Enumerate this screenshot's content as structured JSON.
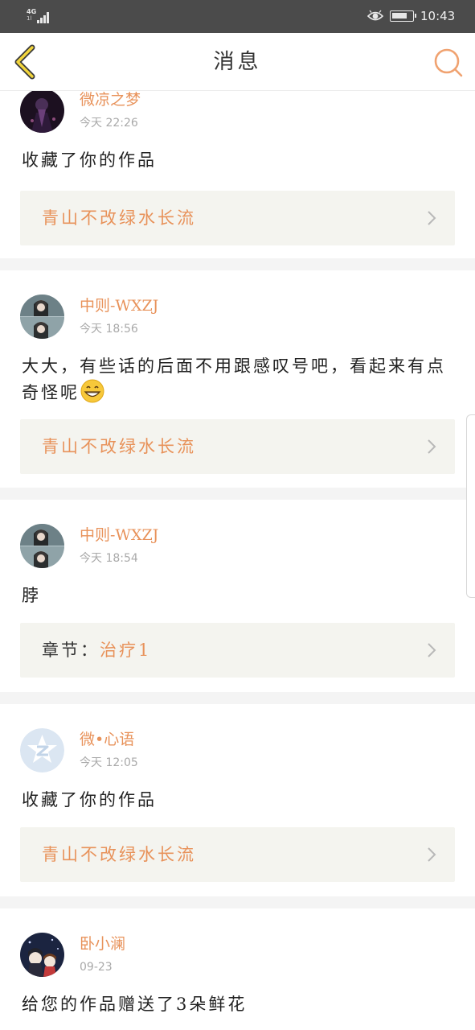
{
  "status_bar": {
    "network": "4G",
    "network_sub": "1l",
    "time": "10:43",
    "signal_icon": "signal-bars-icon",
    "eye_icon": "eye-comfort-icon",
    "battery_icon": "battery-icon",
    "battery_level": 0.75
  },
  "nav": {
    "title": "消息",
    "back_icon": "back-chevron-icon",
    "search_icon": "search-icon"
  },
  "messages": [
    {
      "user": "微凉之梦",
      "time": "今天 22:26",
      "text": "收藏了你的作品",
      "link_prefix": "",
      "link": "青山不改绿水长流"
    },
    {
      "user": "中则-WXZJ",
      "time": "今天 18:56",
      "text": "大大，有些话的后面不用跟感叹号吧，看起来有点奇怪呢",
      "link_prefix": "",
      "link": "青山不改绿水长流"
    },
    {
      "user": "中则-WXZJ",
      "time": "今天 18:54",
      "text": "脖",
      "link_prefix": "章节：",
      "link": "治疗1"
    },
    {
      "user": "微•心语",
      "time": "今天 12:05",
      "text": "收藏了你的作品",
      "link_prefix": "",
      "link": "青山不改绿水长流"
    },
    {
      "user": "卧小澜",
      "time": "09-23",
      "text": "给您的作品赠送了3朵鲜花",
      "link_prefix": "",
      "link": ""
    }
  ],
  "colors": {
    "accent": "#e8925a",
    "status_bg": "#4b4b4b",
    "link_bg": "#f4f4ef",
    "separator": "#f4f4f4"
  }
}
